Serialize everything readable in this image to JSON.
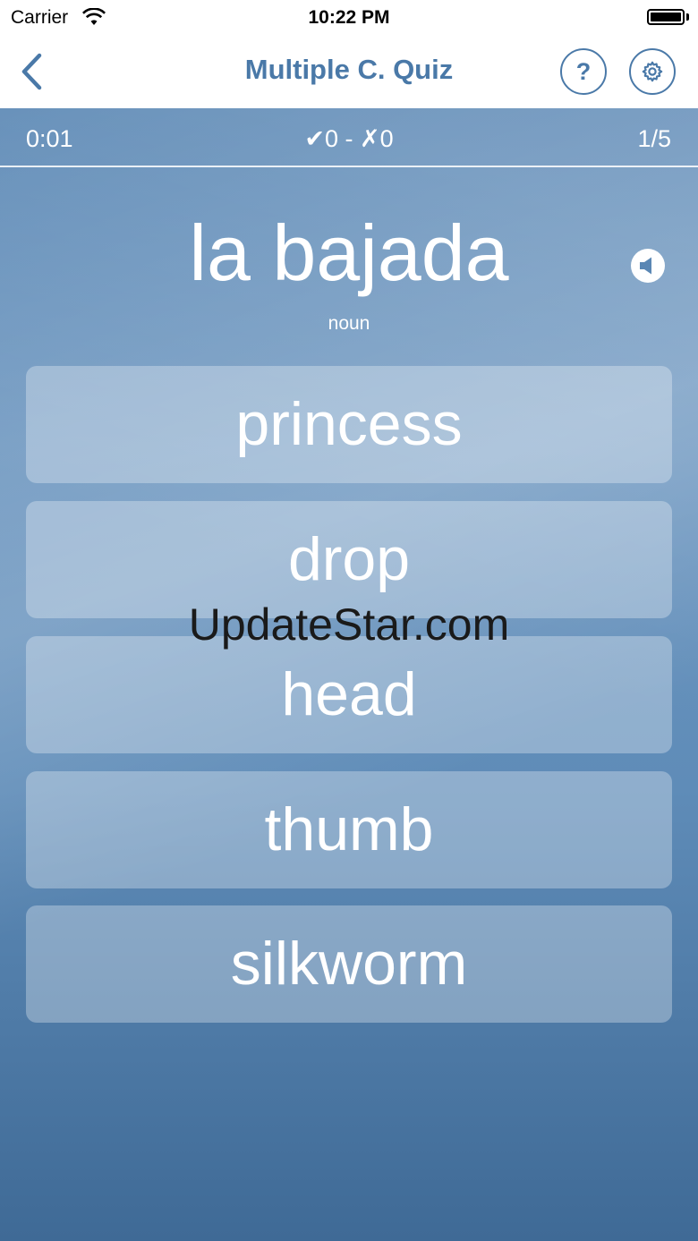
{
  "status_bar": {
    "carrier": "Carrier",
    "time": "10:22 PM"
  },
  "nav": {
    "title": "Multiple C. Quiz",
    "help_label": "?",
    "back_icon": "chevron-left-icon",
    "settings_icon": "gear-icon"
  },
  "quiz": {
    "timer": "0:01",
    "score": "✔0 - ✗0",
    "progress": "1/5"
  },
  "question": {
    "word": "la bajada",
    "part_of_speech": "noun"
  },
  "answers": [
    "princess",
    "drop",
    "head",
    "thumb",
    "silkworm"
  ],
  "watermark": "UpdateStar.com",
  "colors": {
    "accent": "#4a79a8",
    "background": "#5a87b4"
  }
}
